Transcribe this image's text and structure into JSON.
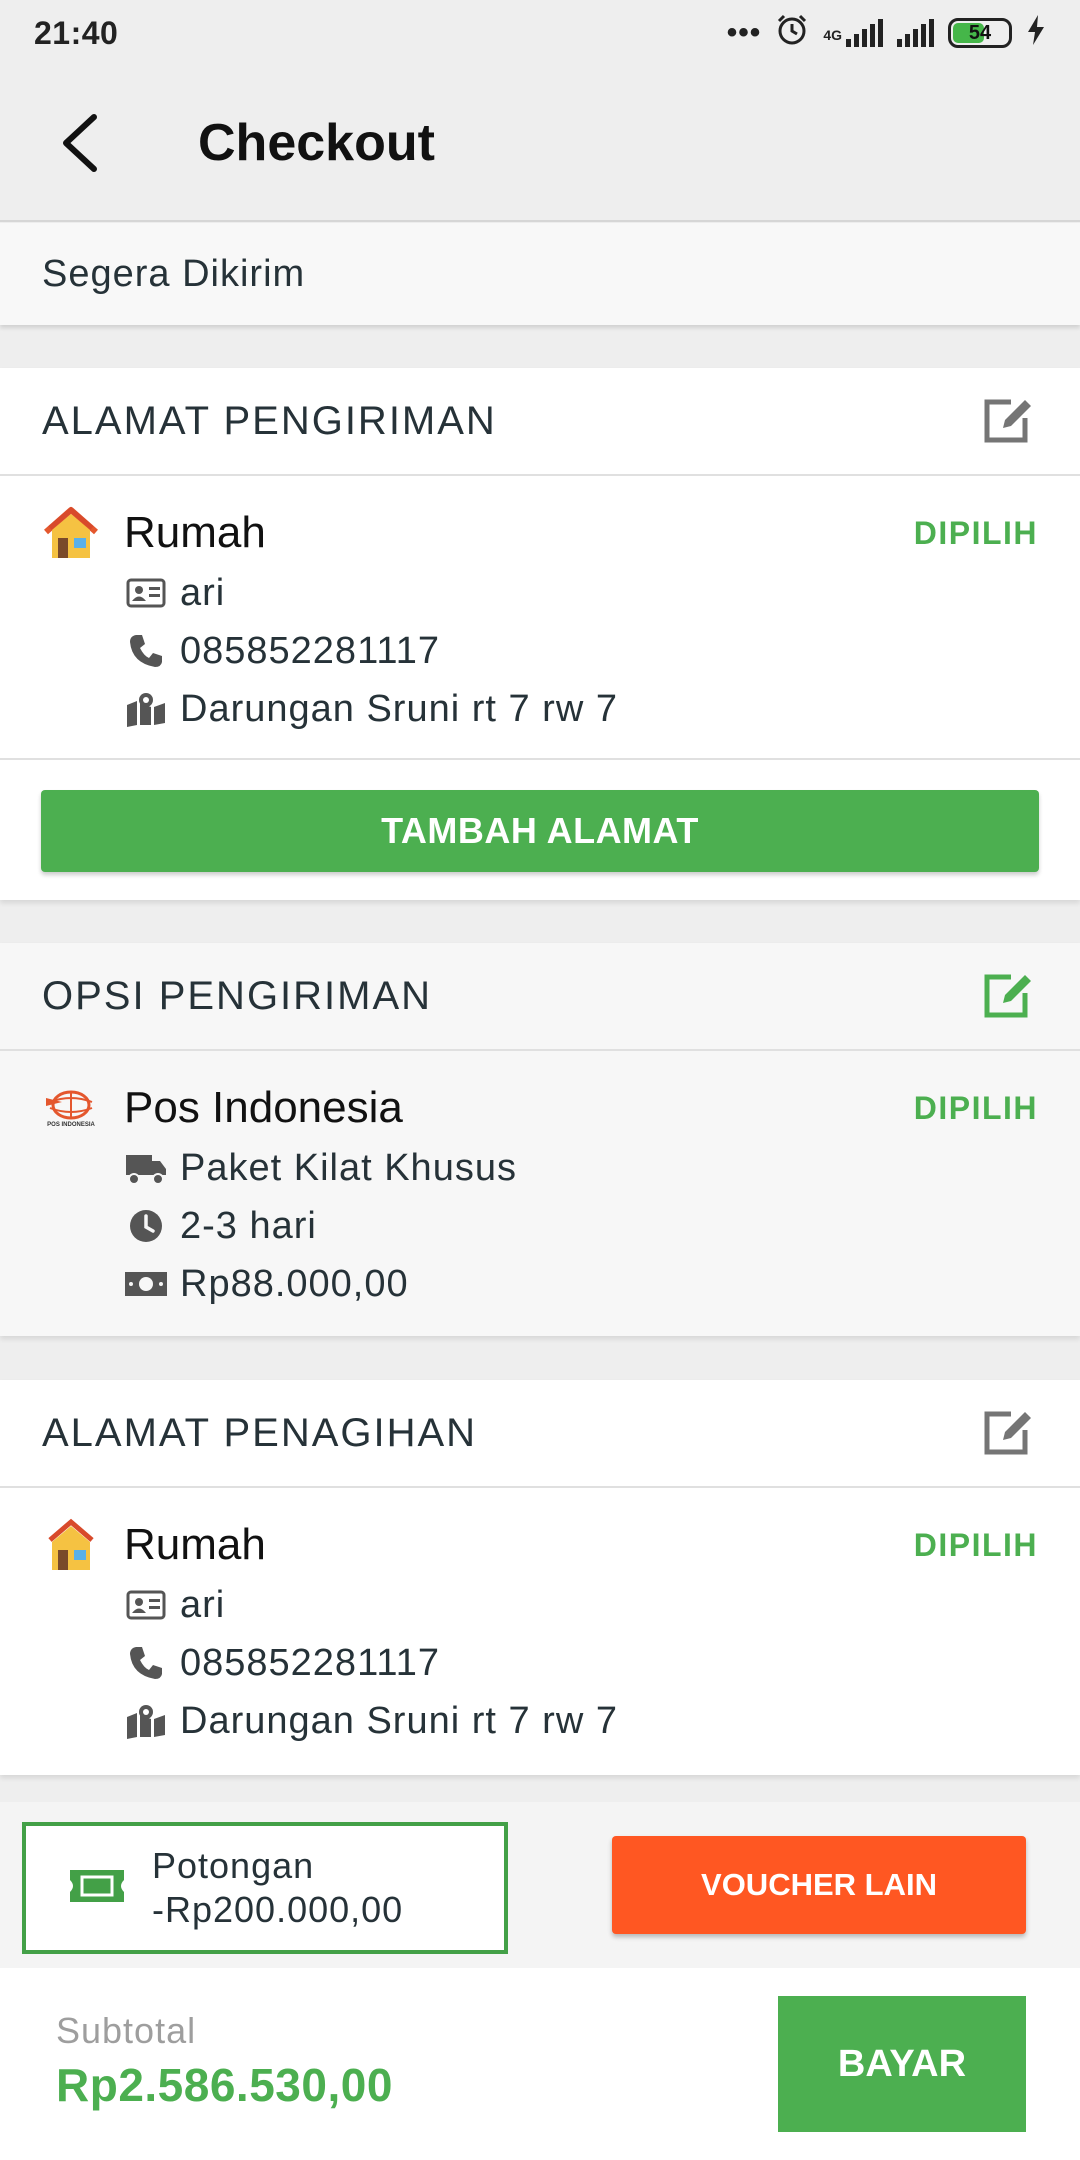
{
  "status_bar": {
    "time": "21:40",
    "network": "4G",
    "battery": "54",
    "battery_level": 0.54
  },
  "app_bar": {
    "title": "Checkout"
  },
  "notice": "Segera Dikirim",
  "shipping_address": {
    "title": "ALAMAT PENGIRIMAN",
    "name": "Rumah",
    "status": "DIPILIH",
    "recipient": "ari",
    "phone": "085852281117",
    "address": "Darungan Sruni rt 7 rw 7",
    "add_button": "TAMBAH ALAMAT"
  },
  "shipping_option": {
    "title": "OPSI PENGIRIMAN",
    "courier": "Pos Indonesia",
    "logo_text": "POS INDONESIA",
    "status": "DIPILIH",
    "service": "Paket Kilat Khusus",
    "duration": "2-3 hari",
    "cost": "Rp88.000,00"
  },
  "billing_address": {
    "title": "ALAMAT PENAGIHAN",
    "name": "Rumah",
    "status": "DIPILIH",
    "recipient": "ari",
    "phone": "085852281117",
    "address": "Darungan Sruni rt 7 rw 7"
  },
  "voucher": {
    "label": "Potongan",
    "amount": "-Rp200.000,00",
    "button": "VOUCHER LAIN"
  },
  "footer": {
    "subtotal_label": "Subtotal",
    "subtotal_value": "Rp2.586.530,00",
    "pay_button": "BAYAR"
  },
  "colors": {
    "accent_green": "#4caf50",
    "voucher_orange": "#ff5722"
  }
}
